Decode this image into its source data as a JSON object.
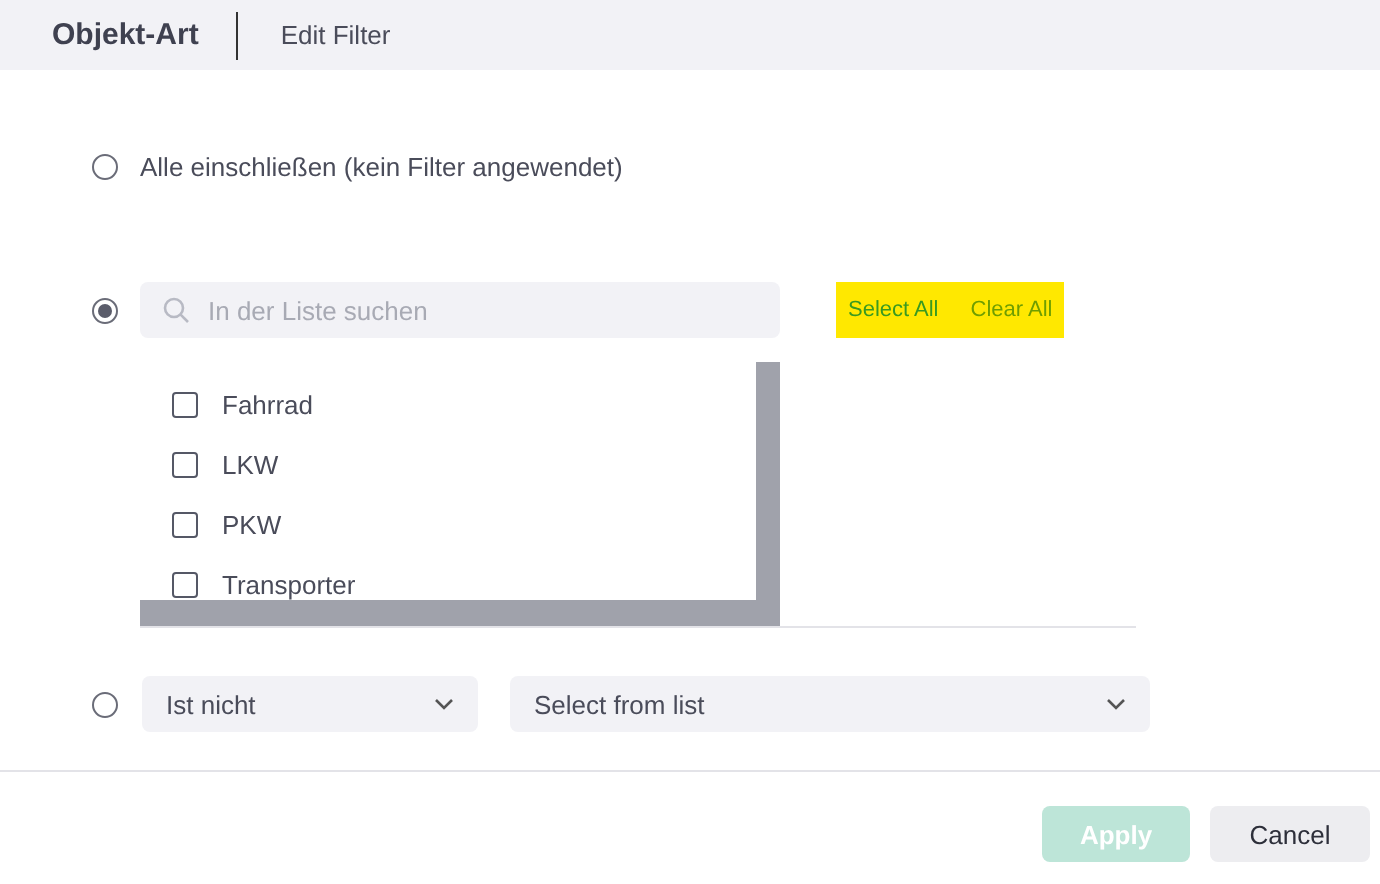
{
  "header": {
    "title": "Objekt-Art",
    "subtitle": "Edit Filter"
  },
  "options": [
    {
      "kind": "all",
      "selected": false,
      "label": "Alle einschließen (kein Filter angewendet)"
    },
    {
      "kind": "list",
      "selected": true,
      "search": {
        "placeholder": "In der Liste suchen"
      },
      "links_highlighted": true,
      "links": [
        {
          "label": "Select All",
          "disabled": false
        },
        {
          "label": "Clear All",
          "disabled": true
        }
      ],
      "items": [
        {
          "label": "Fahrrad",
          "checked": false
        },
        {
          "label": "LKW",
          "checked": false
        },
        {
          "label": "PKW",
          "checked": false
        },
        {
          "label": "Transporter",
          "checked": false
        }
      ]
    },
    {
      "kind": "condition",
      "selected": false,
      "operator": "Ist nicht",
      "value": {
        "placeholder": "Select from list"
      }
    }
  ],
  "buttons": [
    {
      "label": "Apply",
      "kind": "primary",
      "disabled": true
    },
    {
      "label": "Cancel",
      "kind": "secondary"
    }
  ]
}
